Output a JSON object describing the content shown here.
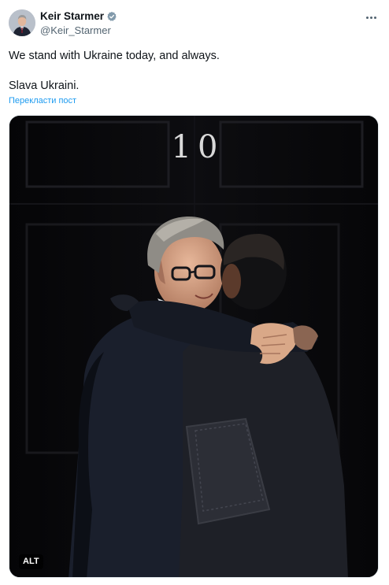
{
  "author": {
    "display_name": "Keir Starmer",
    "handle": "@Keir_Starmer",
    "verified_icon": "verified-badge-icon"
  },
  "tweet": {
    "text_line_1": "We stand with Ukraine today, and always.",
    "text_line_2": "Slava Ukraini.",
    "translate_label": "Перекласти пост"
  },
  "media": {
    "door_number": "10",
    "alt_label": "ALT"
  },
  "colors": {
    "link": "#1d9bf0",
    "secondary_text": "#536471",
    "verified": "#829aab"
  }
}
